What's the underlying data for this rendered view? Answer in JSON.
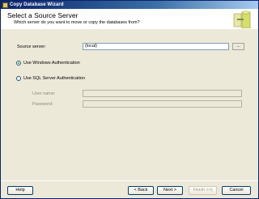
{
  "window": {
    "title": "Copy Database Wizard"
  },
  "header": {
    "title": "Select a Source Server",
    "subtitle": "Which server do you want to move or copy the databases from?"
  },
  "source_server": {
    "label": "Source server:",
    "value": "(local)",
    "browse_label": "..."
  },
  "auth": {
    "windows_label": "Use Windows Authentication",
    "windows_selected": true,
    "sql_label": "Use SQL Server Authentication",
    "sql_selected": false,
    "username_label": "User name:",
    "password_label": "Password:"
  },
  "buttons": {
    "help": "Help",
    "back": "< Back",
    "next": "Next >",
    "finish": "Finish >>|",
    "cancel": "Cancel"
  }
}
